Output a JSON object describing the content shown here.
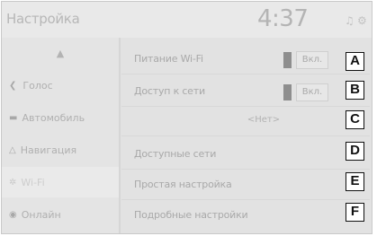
{
  "header": {
    "title": "Настройка",
    "clock": "4:37",
    "icons": [
      "sound-icon",
      "settings-icon"
    ]
  },
  "sidebar": {
    "items": [
      {
        "label": "",
        "icon": "up-arrow-icon"
      },
      {
        "label": "Голос",
        "icon": "voice-icon"
      },
      {
        "label": "Автомобиль",
        "icon": "car-icon"
      },
      {
        "label": "Навигация",
        "icon": "navigation-icon"
      },
      {
        "label": "Wi-Fi",
        "icon": "wifi-icon"
      },
      {
        "label": "Онлайн",
        "icon": "online-icon"
      }
    ]
  },
  "list": {
    "rows": [
      {
        "label": "Питание Wi-Fi",
        "value": "Вкл.",
        "callout": "A"
      },
      {
        "label": "Доступ к сети",
        "value": "Вкл.",
        "callout": "B"
      },
      {
        "label": "",
        "value": "<Нет>",
        "callout": "C"
      },
      {
        "label": "Доступные сети",
        "value": "",
        "callout": "D"
      },
      {
        "label": "Простая настройка",
        "value": "",
        "callout": "E"
      },
      {
        "label": "Подробные настройки",
        "value": "",
        "callout": "F"
      }
    ]
  }
}
